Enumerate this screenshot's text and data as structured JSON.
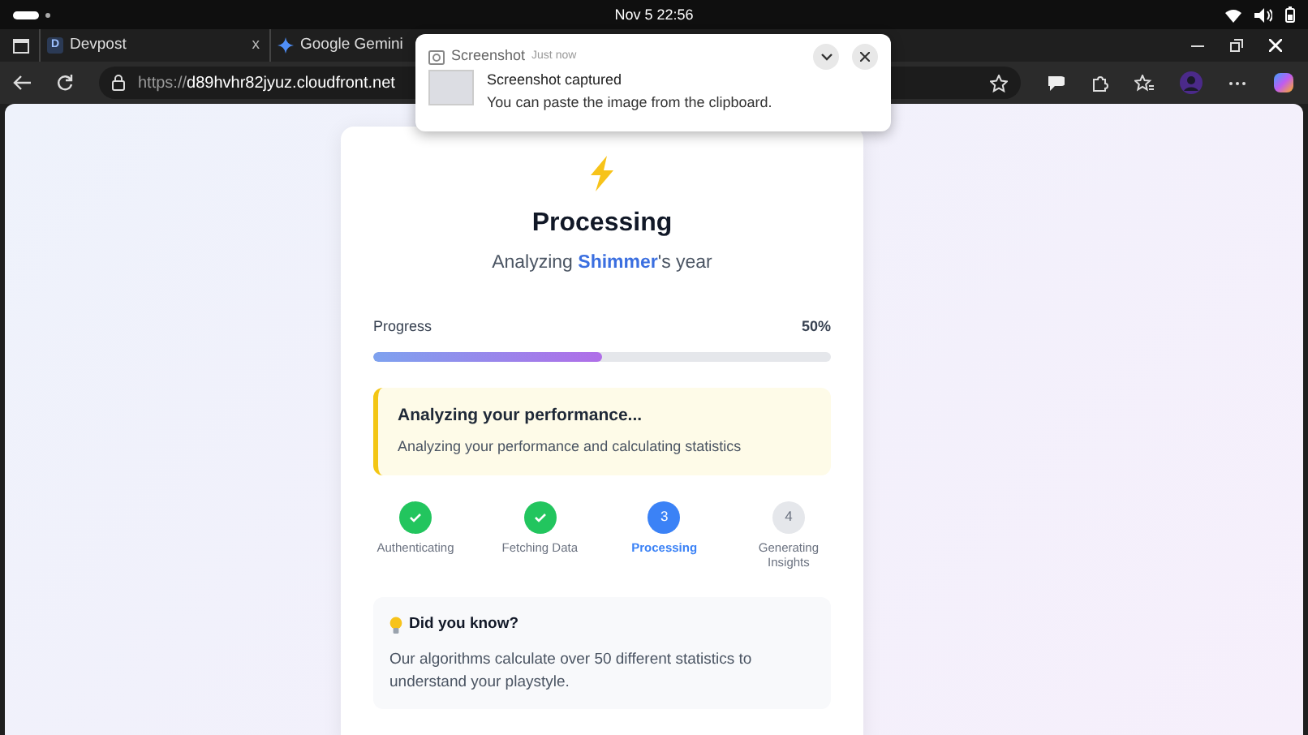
{
  "system_bar": {
    "clock": "Nov 5  22:56"
  },
  "tabs": [
    {
      "title": "Devpost",
      "favicon": "D",
      "selected": false,
      "close": "x"
    },
    {
      "title": "Google Gemini",
      "selected": false
    }
  ],
  "address_bar": {
    "scheme": "https://",
    "host": "d89hvhr82jyuz.cloudfront.net"
  },
  "notification": {
    "app": "Screenshot",
    "time": "Just now",
    "title": "Screenshot captured",
    "body": "You can paste the image from the clipboard."
  },
  "card": {
    "title": "Processing",
    "subtitle": "Analyzing **Shimmer**'s year",
    "progress": {
      "label": "Progress",
      "value": "50%",
      "level": 0.5
    },
    "alert": {
      "title": "Analyzing your performance...",
      "text": "Analyzing your performance and calculating statistics"
    },
    "steps": [
      {
        "label": "Authenticating",
        "done": true,
        "active": false
      },
      {
        "label": "Fetching Data",
        "done": true,
        "active": false
      },
      {
        "label": "Processing",
        "number": "3",
        "done": false,
        "active": true
      },
      {
        "label": "Generating Insights",
        "number": "4",
        "done": false,
        "active": false
      }
    ],
    "tip": {
      "title": "Did you know?",
      "text": "Our algorithms calculate over 50 different statistics to understand your playstyle."
    }
  }
}
